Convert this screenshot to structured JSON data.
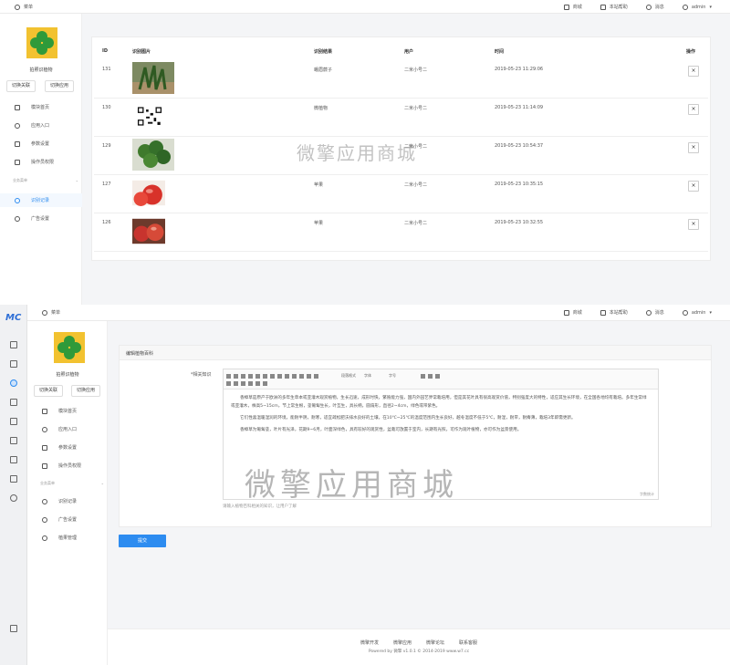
{
  "top_panel": {
    "breadcrumb": "菜单",
    "nav": {
      "shop": "商城",
      "help": "本站帮助",
      "messages": "消息",
      "user": "admin"
    },
    "app": {
      "name": "拍照识植物",
      "switch_account": "切换关联",
      "switch_app": "切换应用"
    },
    "menu": [
      {
        "label": "模块首页",
        "icon": "home-icon"
      },
      {
        "label": "应用入口",
        "icon": "entry-icon"
      },
      {
        "label": "参数设置",
        "icon": "settings-icon"
      },
      {
        "label": "操作员权限",
        "icon": "permission-icon"
      }
    ],
    "menu_section": "业务菜单",
    "menu_business": [
      {
        "label": "识别记录",
        "icon": "gear-icon",
        "active": true
      },
      {
        "label": "广告设置",
        "icon": "gear-icon",
        "active": false
      }
    ],
    "table": {
      "headers": [
        "ID",
        "识别图片",
        "识别结果",
        "用户",
        "时间",
        "操作"
      ],
      "rows": [
        {
          "id": "131",
          "result": "蛾眉蕨子",
          "user": "二米小号二",
          "time": "2019-05-23 11:29:06",
          "thumb": "plant"
        },
        {
          "id": "130",
          "result": "微植物",
          "user": "二米小号二",
          "time": "2019-05-23 11:14:09",
          "thumb": "qrcode"
        },
        {
          "id": "129",
          "result": "",
          "user": "二米小号二",
          "time": "2019-05-23 10:54:37",
          "thumb": "clover"
        },
        {
          "id": "127",
          "result": "苹果",
          "user": "二米小号二",
          "time": "2019-05-23 10:35:15",
          "thumb": "apple"
        },
        {
          "id": "126",
          "result": "苹果",
          "user": "二米小号二",
          "time": "2019-05-23 10:32:55",
          "thumb": "apple"
        }
      ],
      "delete_label": "×"
    },
    "watermark": "微擎应用商城"
  },
  "bottom_panel": {
    "logo_text": "MC",
    "breadcrumb": "菜单",
    "nav": {
      "shop": "商城",
      "help": "本站帮助",
      "messages": "消息",
      "user": "admin"
    },
    "app": {
      "name": "拍照识植物",
      "switch_account": "切换关联",
      "switch_app": "切换应用"
    },
    "menu": [
      {
        "label": "模块首页",
        "icon": "home-icon"
      },
      {
        "label": "应用入口",
        "icon": "entry-icon"
      },
      {
        "label": "参数设置",
        "icon": "settings-icon"
      },
      {
        "label": "操作员权限",
        "icon": "permission-icon"
      }
    ],
    "menu_section": "业务菜单",
    "menu_business": [
      {
        "label": "识别记录",
        "icon": "gear-icon"
      },
      {
        "label": "广告设置",
        "icon": "gear-icon"
      },
      {
        "label": "植果管理",
        "icon": "gear-icon"
      }
    ],
    "form": {
      "section_title": "编辑植物百科",
      "field_label": "*相关知识",
      "toolbar": {
        "paragraph": "段落格式",
        "font": "字体",
        "size": "字号"
      },
      "paragraphs": [
        "香樟草是原产于欧洲的多年生草本或亚灌木观赏植物，生长迅速，成形时快，繁殖能力强，国内外园艺界常栽培用，但是其花叶具有很高观赏价值，特别强度大的特性，适应其生长环境，在全国各地均有栽培。多年生常绿或亚灌木，株高5~15cm，节上常生根，茎匍匐生长，叶互生，具长柄，圆扇形，直径2~4cm，绿色或带紫色。",
        "它们性喜温暖湿润的环境，能耐半阴，耐寒，适宜疏松肥沃排水良好的土壤，在10℃~25℃的温度范围内生长良好，越冬温度不低于5℃，耐湿，耐旱，耐瘠薄，栽培3年即需更新。",
        "香樟草为匍匐茎，叶片有光泽，花期9~6月，叶面深绿色，具有较好的观赏性，盆栽可放置于室内，长期有光照，可作为观叶植物，亦可作为盆景使用。"
      ],
      "word_count": "字数统计",
      "hint": "请输入植物百科相关的知识，让用户了解",
      "submit": "提交"
    },
    "footer_links": [
      "微擎开发",
      "微擎应用",
      "微擎论坛",
      "联系客服"
    ],
    "footer_copyright": "Powered by 微擎 v1.0.1 © 2014-2019 www.w7.cc",
    "watermark": "微擎应用商城"
  }
}
